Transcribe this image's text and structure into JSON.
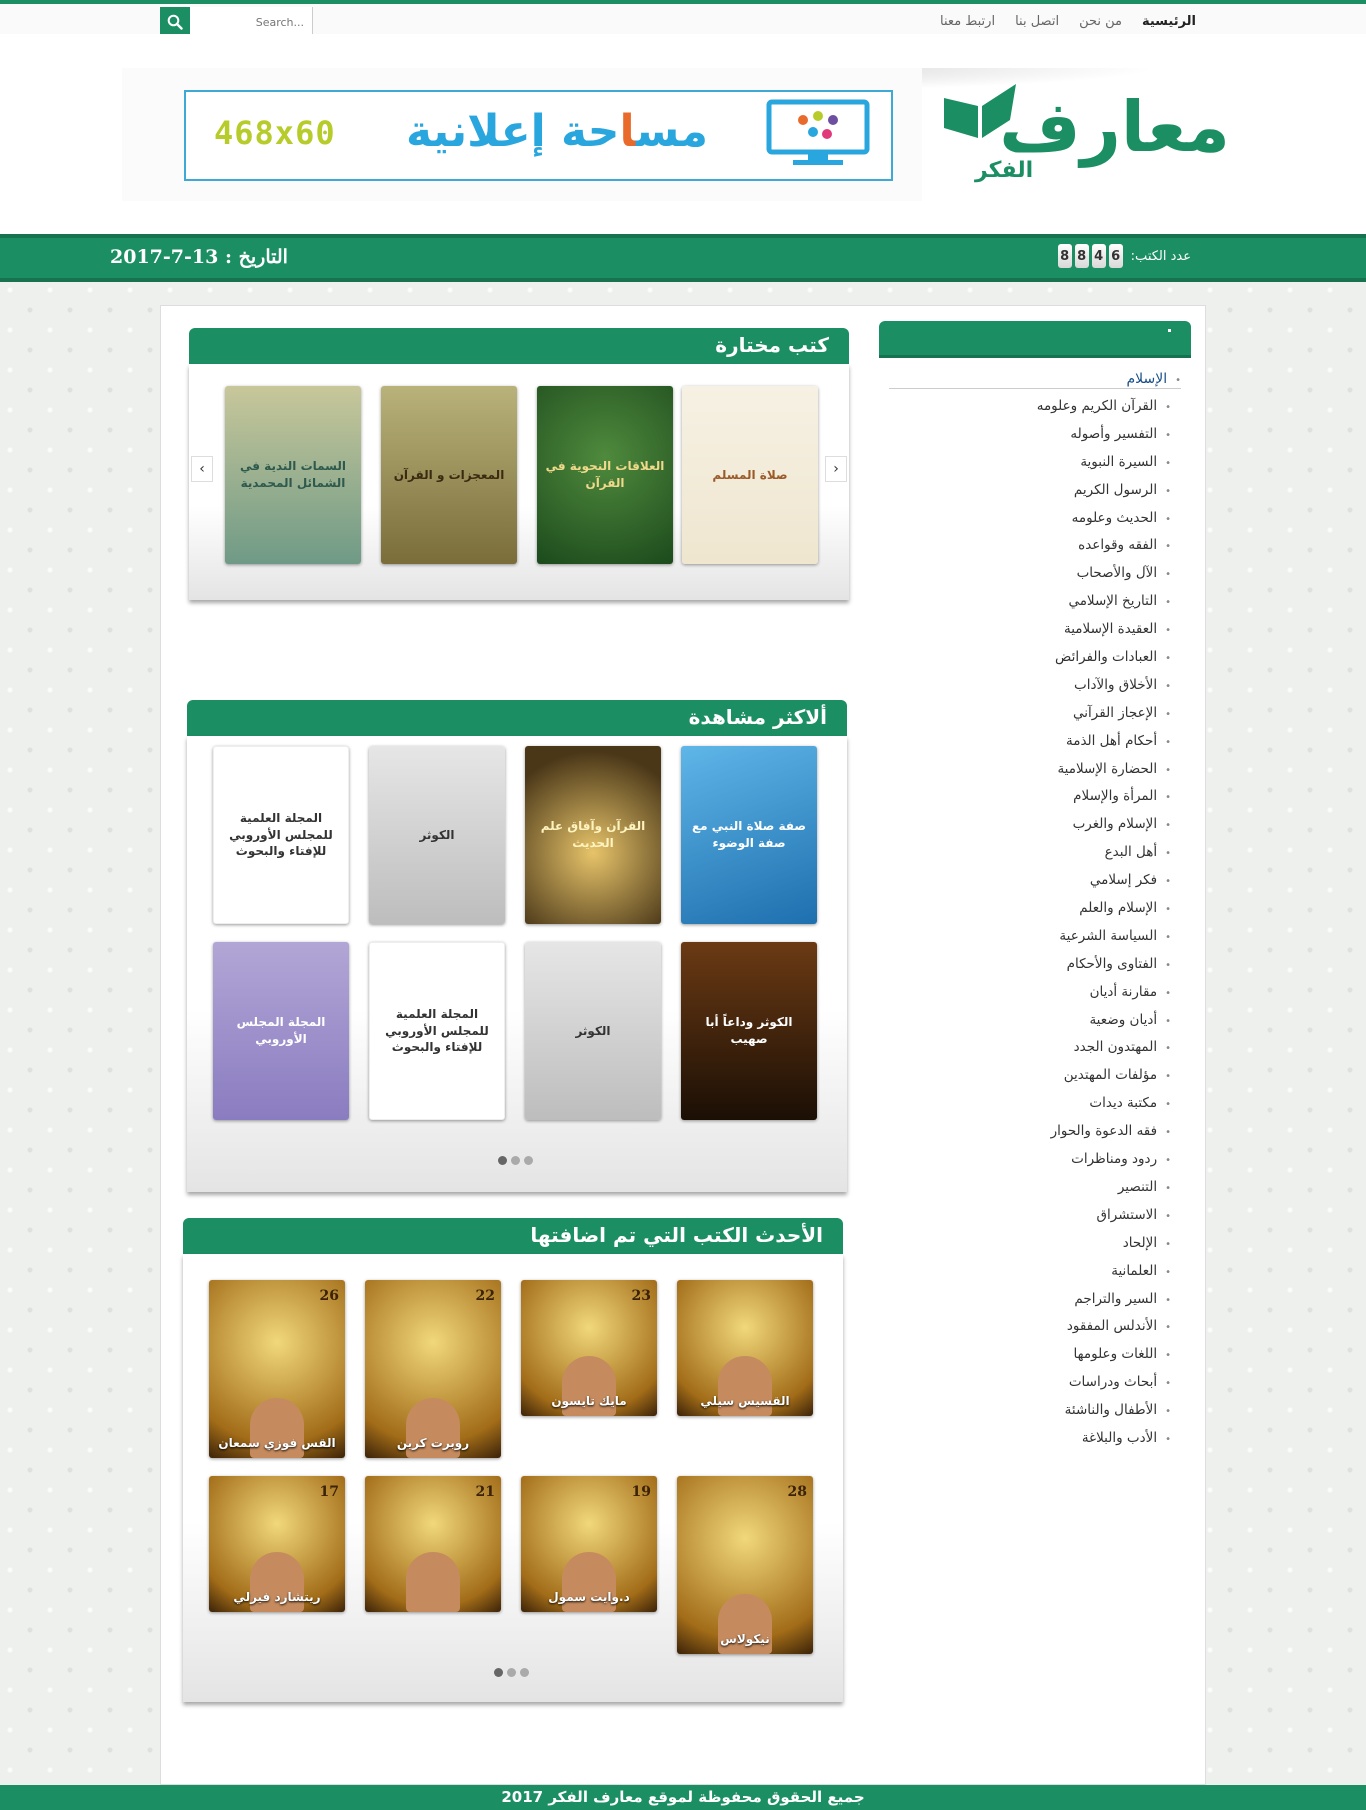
{
  "nav": {
    "items": [
      "الرئيسية",
      "من نحن",
      "اتصل بنا",
      "ارتبط معنا"
    ],
    "search_placeholder": "Search..."
  },
  "header": {
    "logo_main": "معارف",
    "logo_sub": "الفكر",
    "ad_size": "468x60",
    "ad_text_a": "مس",
    "ad_text_o": "ا",
    "ad_text_b": "حة إعل",
    "ad_text_o2": "ا",
    "ad_text_c": "نية"
  },
  "infobar": {
    "counter_label": "عدد الكتب:",
    "counter_digits": [
      "8",
      "8",
      "4",
      "6"
    ],
    "date": "التاريخ : 13-7-2017"
  },
  "sections": {
    "featured": {
      "title": "كتب مختارة",
      "books": [
        {
          "text": "صلاة المسلم",
          "style": "c-cream"
        },
        {
          "text": "العلاقات النحوية في القرآن",
          "style": "c-green"
        },
        {
          "text": "المعجزات و القرآن",
          "style": "c-olive"
        },
        {
          "text": "السمات الندية في الشمائل المحمدية",
          "style": "c-teal"
        }
      ]
    },
    "most_viewed": {
      "title": "ألاكثر مشاهدة",
      "books": [
        {
          "text": "صفة صلاة النبي مع صفة الوضوء",
          "style": "c-blue"
        },
        {
          "text": "القرآن وآفاق علم الحديث",
          "style": "c-mosque"
        },
        {
          "text": "الكوثر",
          "style": "c-person"
        },
        {
          "text": "المجلة العلمية للمجلس الأوروبي للإفتاء والبحوث",
          "style": "c-white"
        },
        {
          "text": "الكوثر وداعاً أبا صهيب",
          "style": "c-kawthar"
        },
        {
          "text": "الكوثر",
          "style": "c-person"
        },
        {
          "text": "المجلة العلمية للمجلس الأوروبي للإفتاء والبحوث",
          "style": "c-white"
        },
        {
          "text": "المجلة المجلس الأوروبي",
          "style": "c-purple"
        }
      ]
    },
    "latest": {
      "title": "الأحدث الكتب التي تم اضافتها",
      "books": [
        {
          "num": "",
          "name": "القسيس سيلي"
        },
        {
          "num": "23",
          "name": "مايك تايسون"
        },
        {
          "num": "22",
          "name": "روبرت كرين"
        },
        {
          "num": "26",
          "name": "القس فوزي سمعان"
        },
        {
          "num": "28",
          "name": "نيكولاس"
        },
        {
          "num": "19",
          "name": "د.وايت سمول"
        },
        {
          "num": "21",
          "name": ""
        },
        {
          "num": "17",
          "name": "ريتشارد فيرلي"
        }
      ]
    }
  },
  "sidebar": {
    "top": "الإسلام",
    "items": [
      "القرآن الكريم وعلومه",
      "التفسير وأصوله",
      "السيرة النبوية",
      "الرسول الكريم",
      "الحديث وعلومه",
      "الفقه وقواعده",
      "الآل والأصحاب",
      "التاريخ الإسلامي",
      "العقيدة الإسلامية",
      "العبادات والفرائض",
      "الأخلاق والآداب",
      "الإعجاز القرآني",
      "أحكام أهل الذمة",
      "الحضارة الإسلامية",
      "المرأة والإسلام",
      "الإسلام والغرب",
      "أهل البدع",
      "فكر إسلامي",
      "الإسلام والعلم",
      "السياسة الشرعية",
      "الفتاوى والأحكام",
      "مقارنة أديان",
      "أديان وضعية",
      "المهتدون الجدد",
      "مؤلفات المهتدين",
      "مكتبة ديدات",
      "فقه الدعوة والحوار",
      "ردود ومناظرات",
      "التنصير",
      "الاستشراق",
      "الإلحاد",
      "العلمانية",
      "السير والتراجم",
      "الأندلس المفقود",
      "اللغات وعلومها",
      "أبحاث ودراسات",
      "الأطفال والناشئة",
      "الأدب والبلاغة"
    ]
  },
  "footer": {
    "text": "جميع الحقوق محفوظة لموقع معارف الفكر 2017"
  },
  "colors": {
    "brand_green": "#1b8f63",
    "brand_green_dark": "#17724f"
  }
}
